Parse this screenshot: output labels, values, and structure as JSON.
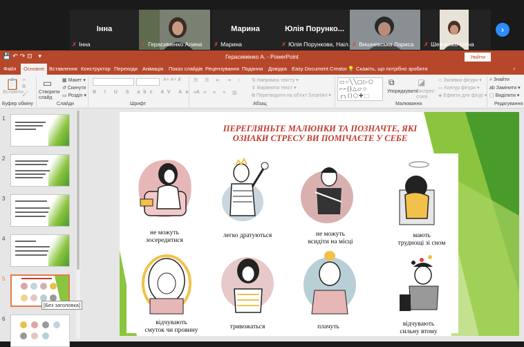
{
  "zoom": {
    "participants": [
      {
        "display": "Інна",
        "caption": "Інна",
        "video": false
      },
      {
        "display": "",
        "caption": "Герасименко Алина",
        "video": true,
        "active": true
      },
      {
        "display": "Марина",
        "caption": "Марина",
        "video": false
      },
      {
        "display": "Юлія Порунко...",
        "caption": "Юлія Порункова, Наіл...",
        "video": false
      },
      {
        "display": "",
        "caption": "Вишневська Лариса",
        "video": true
      },
      {
        "display": "",
        "caption": "Шевченко Ірина",
        "video": true
      }
    ],
    "next_icon": "chevron-right-icon"
  },
  "window": {
    "title": "Герасименко А. - PowerPoint",
    "signin": "Увійти"
  },
  "tabs": [
    "Файл",
    "Основне",
    "Вставлення",
    "Конструктор",
    "Переходи",
    "Анімація",
    "Показ слайдів",
    "Рецензування",
    "Подання",
    "Довідка",
    "Easy Document Creator"
  ],
  "selected_tab": "Основне",
  "tellme": "Скажіть, що потрібно зробити",
  "ribbon": {
    "paste": "Вставити",
    "clipboard_group": "Буфер обміну",
    "new_slide": "Створити слайд",
    "layout": "Макет",
    "reset": "Скинути",
    "section": "Розділ",
    "slides_group": "Слайди",
    "font_group": "Шрифт",
    "text_dir": "Напрямок тексту",
    "align_text": "Вирівняти текст",
    "smartart": "Перетворити на об'єкт SmartArt",
    "para_group": "Абзац",
    "arrange": "Упорядкувати",
    "quick_styles": "Експрес-стилі",
    "fill": "Заливка фігури",
    "outline": "Контур фігури",
    "effects": "Ефекти для фігур",
    "draw_group": "Малювання",
    "find": "Знайти",
    "replace": "Замінити",
    "select": "Виділити",
    "edit_group": "Редагування"
  },
  "thumbs": [
    {
      "n": "1",
      "lines": 3
    },
    {
      "n": "2",
      "lines": 5
    },
    {
      "n": "3",
      "lines": 4
    },
    {
      "n": "4",
      "lines": 4
    },
    {
      "n": "5",
      "selected": true
    },
    {
      "n": "6"
    }
  ],
  "thumb_tooltip": "[Без заголовка]",
  "slide": {
    "title_line1": "ПЕРЕГЛЯНЬТЕ МАЛЮНКИ ТА ПОЗНАЧТЕ, ЯКІ",
    "title_line2": "ОЗНАКИ СТРЕСУ ВИ ПОМІЧАЄТЕ У СЕБЕ",
    "captions": [
      [
        "не можуть",
        "зосередитися"
      ],
      [
        "легко дратуються"
      ],
      [
        "не можуть",
        "всидіти на місці"
      ],
      [
        "мають",
        "труднощі зі сном"
      ],
      [
        "відчувають",
        "смуток чи провину"
      ],
      [
        "тривожаться"
      ],
      [
        "плачуть"
      ],
      [
        "відчувають",
        "сильну втому"
      ]
    ],
    "colors": {
      "title": "#c0392b",
      "green_light": "#8bc53f",
      "green_dark": "#4a9c2a"
    }
  }
}
